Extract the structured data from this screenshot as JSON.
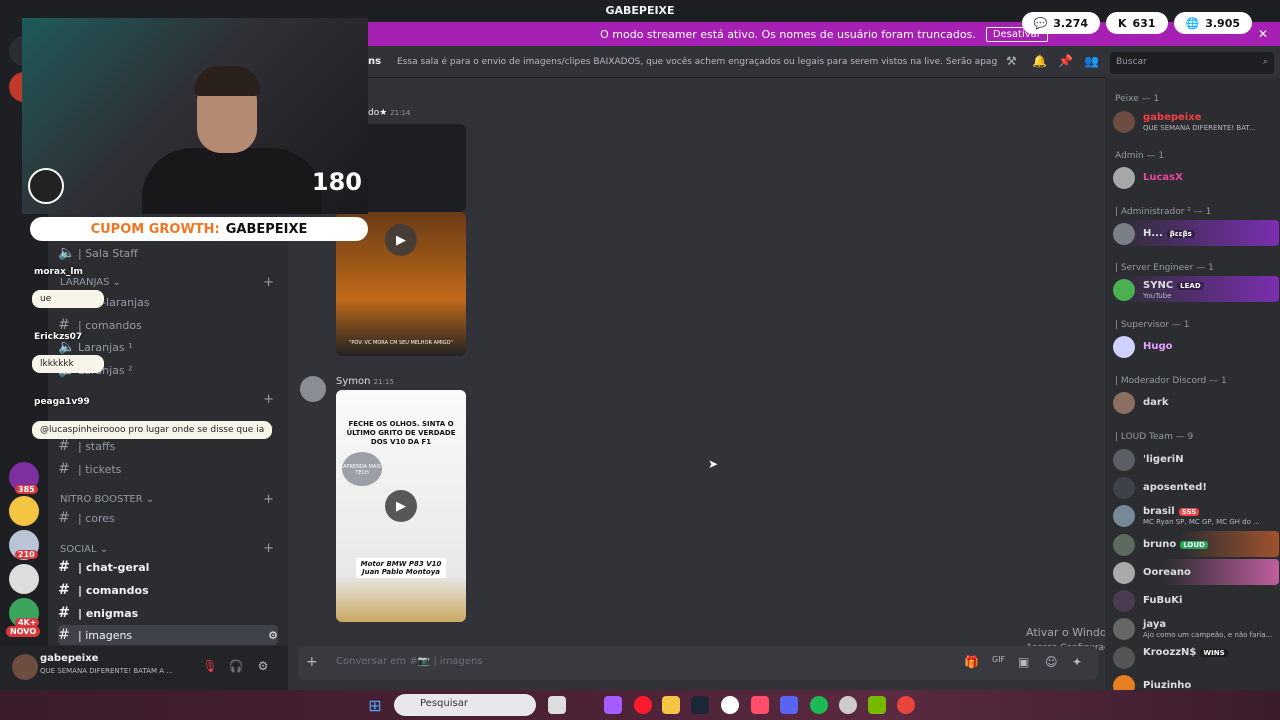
{
  "window": {
    "title": "GABEPEIXE"
  },
  "stats": {
    "chat": "3.274",
    "kick": "631",
    "viewers": "3.905"
  },
  "banner": {
    "text": "O modo streamer está ativo. Os nomes de usuário foram truncados.",
    "button": "Desativar"
  },
  "overlay": {
    "cam_number": "180",
    "coupon_prefix": "CUPOM GROWTH:",
    "coupon_code": "GABEPEIXE"
  },
  "stream_chat": [
    {
      "name": "morax_lm"
    },
    {
      "text": "ue"
    },
    {
      "name": "Erickzs07"
    },
    {
      "text": "lkkkkkk"
    },
    {
      "name": "peaga1v99"
    },
    {
      "text": "@lucaspinheiroooo pro lugar onde se disse que ia"
    }
  ],
  "sidebar": {
    "items": [
      {
        "label": "| Sala Staff",
        "icon": "speaker-icon"
      },
      {
        "label": "chat-laranjas"
      },
      {
        "label": "| comandos"
      },
      {
        "label": "Laranjas ¹"
      },
      {
        "label": "Laranjas ²"
      },
      {
        "label": "| staffs"
      },
      {
        "label": "| tickets"
      },
      {
        "label": "| cores"
      },
      {
        "label": "| chat-geral"
      },
      {
        "label": "| comandos"
      },
      {
        "label": "| enigmas"
      },
      {
        "label": "| imagens"
      }
    ],
    "categories": {
      "laranjas": "LARANJAS",
      "nitro": "NITRO BOOSTER",
      "social": "SOCIAL"
    }
  },
  "server_badges": [
    "385",
    "210",
    "4K+",
    "NOVO"
  ],
  "user": {
    "name": "gabepeixe",
    "status": "QUE SEMANA DIFERENTE! BATAM A ..."
  },
  "header": {
    "channel_fragment": "ns",
    "topic": "Essa sala é para o envio de imagens/clipes BAIXADOS, que vocês achem engraçados ou legais para serem vistos na live. Serão apagados prints de o...",
    "search_placeholder": "Buscar"
  },
  "messages": [
    {
      "author_fragment": "do★",
      "time": "21:14"
    },
    {
      "author": "Symon",
      "time": "21:15",
      "video_text_top": "FECHE OS OLHOS. SINTA O ÚLTIMO GRITO DE VERDADE DOS V10 DA F1",
      "video_text_bottom": "Motor BMW P83 V10 Juan Pablo Montoya",
      "video_brand": "APRENDA MAIS TECH",
      "video_caption": "\"POV: VC MORA CM SEU MELHOR AMIGO\""
    }
  ],
  "composer": {
    "placeholder": "Conversar em #📷 | imagens"
  },
  "members": {
    "groups": [
      {
        "role": "Peixe — 1"
      },
      {
        "role": "Admin — 1"
      },
      {
        "role": "| Administrador ² — 1"
      },
      {
        "role": "| Server Engineer — 1"
      },
      {
        "role": "| Supervisor — 1"
      },
      {
        "role": "| Moderador Discord — 1"
      },
      {
        "role": "| LOUD Team — 9"
      }
    ],
    "list": [
      {
        "name": "gabepeixe",
        "status": "QUE SEMANA DIFERENTE! BAT...",
        "color": "#f23f43"
      },
      {
        "name": "LucasX",
        "color": "#eb459e"
      },
      {
        "name": "H...",
        "tag": "βεεβs",
        "color": "#ffffff"
      },
      {
        "name": "SYNC",
        "tag": "LEAD",
        "status": "YouTube",
        "color": "#ffffff"
      },
      {
        "name": "Hugo",
        "color": "#e5a0ff"
      },
      {
        "name": "dark",
        "color": "#ffffff"
      },
      {
        "name": "'ligeriN",
        "color": "#ffffff"
      },
      {
        "name": "aposented!",
        "color": "#ffffff"
      },
      {
        "name": "brasil",
        "tag": "SSS",
        "status": "MC Ryan SP, MC GP, MC GH do ...",
        "color": "#ffffff"
      },
      {
        "name": "bruno",
        "tag": "LOUD",
        "color": "#ffffff"
      },
      {
        "name": "Ooreano",
        "color": "#ffffff"
      },
      {
        "name": "FuBuKi",
        "color": "#ffffff"
      },
      {
        "name": "jaya",
        "status": "Ajo como um campeão, e não faria...",
        "color": "#ffffff"
      },
      {
        "name": "KroozzN$",
        "tag": "WINS",
        "color": "#ffffff"
      },
      {
        "name": "Piuzinho",
        "color": "#ffffff"
      }
    ]
  },
  "watermark": {
    "line1": "Ativar o Windows",
    "line2": "Acesse Configurações para ativar o Windows."
  },
  "taskbar": {
    "search": "Pesquisar"
  }
}
